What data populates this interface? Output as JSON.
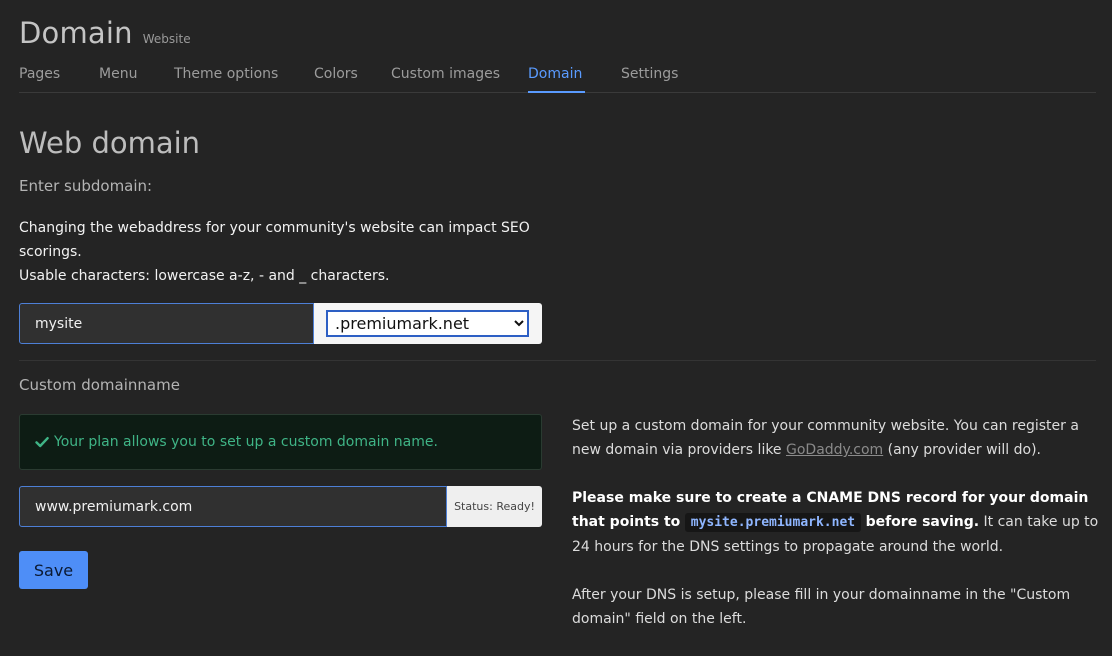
{
  "header": {
    "title": "Domain",
    "subtitle": "Website"
  },
  "tabs": [
    {
      "label": "Pages",
      "active": false
    },
    {
      "label": "Menu",
      "active": false
    },
    {
      "label": "Theme options",
      "active": false
    },
    {
      "label": "Colors",
      "active": false
    },
    {
      "label": "Custom images",
      "active": false
    },
    {
      "label": "Domain",
      "active": true
    },
    {
      "label": "Settings",
      "active": false
    }
  ],
  "web_domain": {
    "title": "Web domain",
    "subdomain_label": "Enter subdomain:",
    "description_line1": "Changing the webaddress for your community's website can impact SEO scorings.",
    "description_line2": "Usable characters: lowercase a-z, - and _ characters.",
    "subdomain_value": "mysite",
    "domain_selected": ".premiumark.net"
  },
  "custom_domain": {
    "label": "Custom domainname",
    "alert_text": "Your plan allows you to set up a custom domain name.",
    "value": "www.premiumark.com",
    "status": "Status: Ready!",
    "save_label": "Save"
  },
  "help": {
    "p1_before": "Set up a custom domain for your community website. You can register a new domain via providers like ",
    "p1_link": "GoDaddy.com",
    "p1_after": " (any provider will do).",
    "p2_bold_before": "Please make sure to create a CNAME DNS record for your domain that points to",
    "p2_code": "mysite.premiumark.net",
    "p2_bold_after": "before saving.",
    "p2_rest": " It can take up to 24 hours for the DNS settings to propagate around the world.",
    "p3": "After your DNS is setup, please fill in your domainname in the \"Custom domain\" field on the left."
  },
  "colors": {
    "accent": "#5a9bff",
    "button": "#4e8ef7",
    "success": "#3fb486"
  },
  "icons": {
    "alert": "check-icon"
  }
}
